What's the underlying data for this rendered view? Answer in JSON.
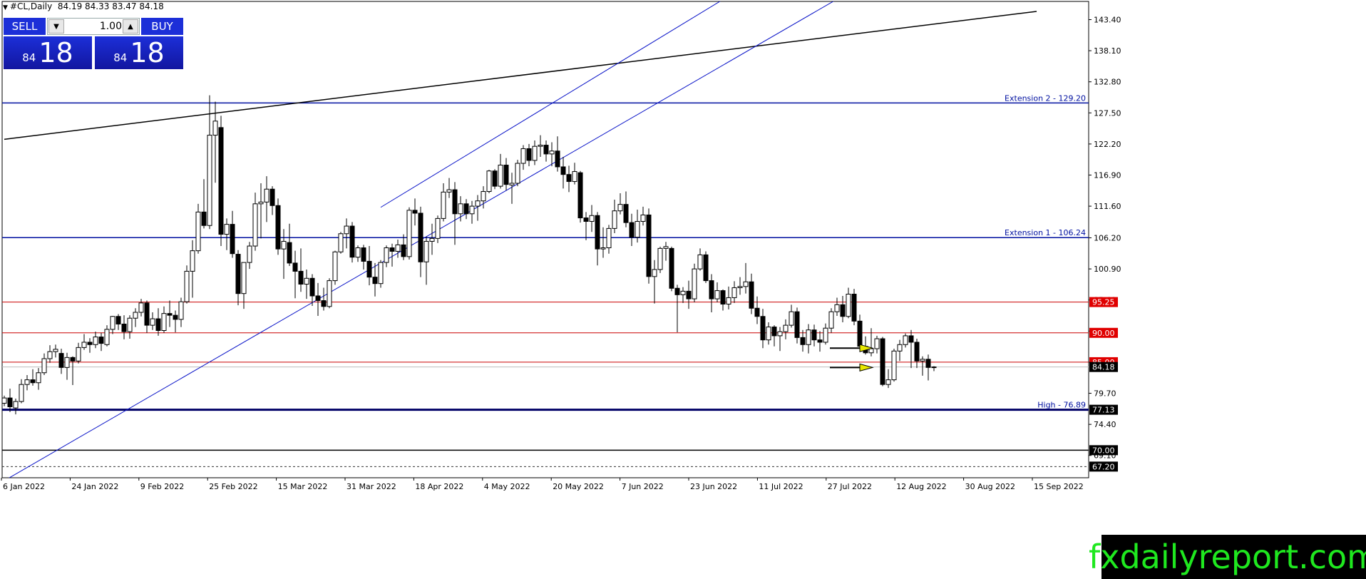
{
  "symbol": {
    "name": "#CL,Daily",
    "ohlc": "84.19 84.33 83.47 84.18"
  },
  "trade_panel": {
    "sell_label": "SELL",
    "buy_label": "BUY",
    "lot_value": "1.00",
    "sell_price_small": "84",
    "sell_price_big": "18",
    "buy_price_small": "84",
    "buy_price_big": "18",
    "down_icon": "triangle-down-icon",
    "up_icon": "triangle-up-icon"
  },
  "watermark": "fxdailyreport.com",
  "chart_data": {
    "type": "candlestick",
    "price_axis_ticks": [
      143.4,
      138.1,
      132.8,
      127.5,
      122.2,
      116.9,
      111.6,
      106.2,
      100.9,
      95.6,
      90.3,
      85.0,
      79.7,
      74.4,
      69.1
    ],
    "price_axis_ticks_text": [
      "143.40",
      "138.10",
      "132.80",
      "127.50",
      "122.20",
      "116.90",
      "111.60",
      "106.20",
      "100.90",
      "95.60",
      "90.30",
      "85.00",
      "79.70",
      "74.40",
      "69.10"
    ],
    "date_labels": [
      "6 Jan 2022",
      "24 Jan 2022",
      "9 Feb 2022",
      "25 Feb 2022",
      "15 Mar 2022",
      "31 Mar 2022",
      "18 Apr 2022",
      "4 May 2022",
      "20 May 2022",
      "7 Jun 2022",
      "23 Jun 2022",
      "11 Jul 2022",
      "27 Jul 2022",
      "12 Aug 2022",
      "30 Aug 2022",
      "15 Sep 2022"
    ],
    "ylim": [
      65.3,
      146.5
    ],
    "horizontal_levels": [
      {
        "price": 129.2,
        "color": "#0010a0",
        "width": 1.5,
        "label": "Extension 2 - 129.20",
        "label_color": "#0010a0"
      },
      {
        "price": 106.24,
        "color": "#0010a0",
        "width": 1.5,
        "label": "Extension 1 - 106.24",
        "label_color": "#0010a0"
      },
      {
        "price": 95.25,
        "color": "#cc0000",
        "width": 1,
        "badge": "95.25",
        "badge_color": "#e00000"
      },
      {
        "price": 90.0,
        "color": "#cc0000",
        "width": 1,
        "badge": "90.00",
        "badge_color": "#e00000"
      },
      {
        "price": 85.0,
        "color": "#cc0000",
        "width": 1,
        "badge": "85.00",
        "badge_color": "#e00000"
      },
      {
        "price": 84.18,
        "color": "#bbbbbb",
        "width": 1,
        "badge": "84.18",
        "badge_color": "#000000"
      },
      {
        "price": 76.89,
        "color": "#000066",
        "width": 3,
        "label": "High - 76.89",
        "label_color": "#0010a0",
        "badge": "77.13",
        "badge_color": "#000000"
      },
      {
        "price": 70.0,
        "color": "#000000",
        "width": 1.5,
        "badge": "70.00",
        "badge_color": "#000000"
      },
      {
        "price": 67.2,
        "color": "#333333",
        "width": 1,
        "dash": true,
        "badge": "67.20",
        "badge_color": "#000000"
      },
      {
        "price": 64.8,
        "color": "#cc0000",
        "width": 1
      }
    ],
    "trendlines": [
      {
        "from": [
          0,
          123.0
        ],
        "to": [
          181,
          144.8
        ],
        "color": "#000000",
        "width": 1.5
      },
      {
        "from": [
          0,
          64.8
        ],
        "to": [
          148,
          148.0
        ],
        "color": "#0a14c8",
        "width": 1
      },
      {
        "from": [
          66,
          111.4
        ],
        "to": [
          128,
          148.0
        ],
        "color": "#0a14c8",
        "width": 1
      }
    ],
    "arrows": [
      {
        "bar": 144,
        "price": 87.4,
        "color": "#e8e800"
      },
      {
        "bar": 144,
        "price": 84.1,
        "color": "#e8e800"
      }
    ],
    "candles": [
      [
        78.0,
        79.3,
        77.5,
        78.9
      ],
      [
        78.9,
        80.5,
        76.5,
        77.4
      ],
      [
        77.2,
        78.8,
        76.1,
        78.3
      ],
      [
        78.3,
        82.1,
        78.0,
        81.2
      ],
      [
        81.2,
        82.8,
        80.2,
        82.0
      ],
      [
        82.0,
        83.8,
        81.0,
        81.5
      ],
      [
        81.5,
        84.0,
        80.3,
        83.2
      ],
      [
        83.2,
        86.5,
        82.8,
        85.6
      ],
      [
        85.6,
        87.9,
        84.9,
        86.8
      ],
      [
        86.8,
        88.0,
        85.8,
        87.2
      ],
      [
        86.5,
        87.3,
        83.0,
        84.1
      ],
      [
        84.1,
        86.6,
        82.0,
        85.8
      ],
      [
        85.8,
        86.0,
        81.1,
        85.2
      ],
      [
        85.2,
        88.3,
        84.8,
        87.5
      ],
      [
        87.5,
        89.8,
        87.1,
        88.4
      ],
      [
        88.4,
        89.1,
        86.6,
        88.0
      ],
      [
        88.0,
        90.2,
        87.4,
        89.3
      ],
      [
        89.3,
        90.0,
        86.9,
        88.2
      ],
      [
        88.0,
        91.3,
        87.7,
        90.6
      ],
      [
        90.6,
        92.9,
        89.8,
        92.8
      ],
      [
        92.8,
        93.2,
        90.5,
        91.5
      ],
      [
        91.5,
        93.0,
        88.9,
        90.2
      ],
      [
        90.2,
        93.0,
        89.0,
        92.5
      ],
      [
        92.5,
        94.2,
        91.0,
        93.5
      ],
      [
        93.5,
        95.8,
        92.8,
        95.1
      ],
      [
        95.1,
        95.5,
        90.0,
        91.3
      ],
      [
        91.3,
        93.5,
        90.5,
        92.4
      ],
      [
        92.4,
        94.2,
        89.5,
        90.4
      ],
      [
        90.4,
        94.5,
        90.0,
        93.3
      ],
      [
        93.3,
        95.5,
        91.0,
        93.0
      ],
      [
        93.0,
        93.8,
        90.1,
        92.3
      ],
      [
        92.3,
        96.0,
        91.0,
        95.3
      ],
      [
        95.3,
        101.5,
        95.0,
        100.5
      ],
      [
        100.5,
        105.8,
        96.0,
        104.0
      ],
      [
        104.0,
        112.0,
        103.5,
        110.6
      ],
      [
        110.6,
        116.2,
        107.8,
        108.3
      ],
      [
        108.3,
        130.5,
        107.7,
        123.7
      ],
      [
        123.7,
        129.4,
        115.6,
        126.1
      ],
      [
        125.0,
        127.0,
        104.8,
        106.8
      ],
      [
        106.8,
        109.5,
        104.1,
        108.5
      ],
      [
        108.5,
        110.8,
        102.8,
        103.5
      ],
      [
        103.4,
        104.1,
        94.7,
        96.7
      ],
      [
        96.7,
        98.5,
        94.1,
        102.0
      ],
      [
        102.0,
        105.5,
        100.9,
        104.8
      ],
      [
        104.8,
        113.9,
        104.0,
        112.0
      ],
      [
        112.0,
        115.5,
        106.1,
        112.3
      ],
      [
        112.3,
        116.7,
        108.9,
        114.5
      ],
      [
        114.5,
        115.0,
        110.1,
        111.7
      ],
      [
        111.7,
        112.9,
        103.3,
        104.3
      ],
      [
        104.3,
        107.7,
        99.2,
        105.6
      ],
      [
        105.4,
        108.6,
        101.4,
        101.9
      ],
      [
        101.9,
        104.0,
        95.9,
        100.5
      ],
      [
        100.5,
        104.4,
        97.0,
        98.3
      ],
      [
        98.3,
        100.8,
        95.8,
        99.3
      ],
      [
        99.3,
        100.0,
        94.6,
        96.3
      ],
      [
        96.3,
        98.5,
        92.9,
        95.5
      ],
      [
        95.5,
        97.7,
        93.8,
        94.5
      ],
      [
        94.5,
        99.3,
        94.2,
        98.9
      ],
      [
        98.9,
        104.0,
        98.2,
        103.8
      ],
      [
        103.8,
        107.2,
        103.5,
        106.9
      ],
      [
        106.9,
        109.5,
        104.4,
        108.2
      ],
      [
        108.2,
        108.9,
        102.0,
        102.9
      ],
      [
        102.9,
        104.9,
        102.1,
        104.5
      ],
      [
        104.5,
        105.0,
        100.8,
        102.2
      ],
      [
        102.2,
        104.8,
        98.1,
        99.5
      ],
      [
        99.5,
        101.9,
        96.2,
        98.4
      ],
      [
        98.4,
        102.4,
        97.7,
        102.0
      ],
      [
        102.0,
        104.9,
        101.2,
        104.5
      ],
      [
        104.5,
        105.2,
        101.3,
        103.9
      ],
      [
        103.9,
        105.9,
        102.8,
        105.0
      ],
      [
        105.0,
        106.8,
        102.4,
        103.0
      ],
      [
        103.0,
        111.4,
        102.5,
        110.9
      ],
      [
        110.9,
        112.9,
        108.3,
        110.4
      ],
      [
        110.4,
        111.5,
        99.5,
        102.1
      ],
      [
        102.1,
        106.4,
        98.2,
        105.6
      ],
      [
        105.6,
        108.6,
        103.3,
        106.1
      ],
      [
        106.1,
        110.0,
        105.3,
        109.5
      ],
      [
        109.5,
        115.5,
        109.0,
        114.0
      ],
      [
        114.0,
        116.4,
        113.0,
        114.4
      ],
      [
        114.4,
        115.7,
        105.0,
        110.3
      ],
      [
        110.3,
        113.3,
        109.0,
        112.0
      ],
      [
        112.0,
        112.8,
        109.4,
        110.3
      ],
      [
        110.3,
        112.5,
        108.6,
        111.6
      ],
      [
        111.6,
        113.5,
        109.1,
        112.5
      ],
      [
        112.5,
        115.0,
        111.2,
        114.1
      ],
      [
        114.1,
        117.8,
        113.8,
        117.6
      ],
      [
        117.6,
        117.9,
        114.5,
        115.0
      ],
      [
        115.0,
        120.5,
        114.6,
        118.6
      ],
      [
        118.6,
        119.8,
        114.3,
        115.3
      ],
      [
        115.2,
        117.3,
        112.0,
        115.5
      ],
      [
        115.5,
        119.5,
        115.0,
        118.9
      ],
      [
        118.9,
        122.0,
        117.8,
        121.4
      ],
      [
        121.4,
        122.2,
        118.4,
        119.4
      ],
      [
        119.4,
        122.8,
        118.6,
        121.8
      ],
      [
        121.8,
        123.7,
        120.0,
        122.0
      ],
      [
        122.0,
        122.8,
        119.2,
        120.5
      ],
      [
        120.5,
        122.5,
        118.4,
        121.0
      ],
      [
        121.0,
        123.5,
        117.5,
        118.3
      ],
      [
        118.3,
        120.0,
        114.6,
        117.0
      ],
      [
        117.0,
        118.5,
        114.0,
        115.8
      ],
      [
        115.8,
        119.0,
        115.3,
        117.5
      ],
      [
        117.3,
        117.6,
        108.8,
        109.6
      ],
      [
        109.6,
        110.6,
        105.8,
        109.0
      ],
      [
        109.0,
        111.8,
        107.2,
        110.0
      ],
      [
        110.0,
        110.6,
        101.5,
        104.3
      ],
      [
        104.3,
        108.0,
        102.8,
        104.5
      ],
      [
        104.5,
        108.4,
        103.5,
        107.8
      ],
      [
        107.8,
        112.7,
        107.0,
        110.8
      ],
      [
        110.8,
        113.8,
        110.2,
        111.9
      ],
      [
        111.9,
        114.1,
        108.0,
        108.8
      ],
      [
        108.8,
        110.3,
        104.8,
        106.3
      ],
      [
        106.3,
        111.0,
        105.4,
        109.0
      ],
      [
        109.0,
        111.5,
        108.3,
        110.1
      ],
      [
        110.1,
        111.2,
        98.4,
        99.6
      ],
      [
        99.6,
        102.4,
        95.0,
        100.8
      ],
      [
        100.8,
        104.7,
        100.2,
        104.4
      ],
      [
        104.4,
        105.5,
        102.3,
        104.7
      ],
      [
        104.4,
        104.7,
        97.1,
        97.6
      ],
      [
        97.6,
        98.2,
        90.1,
        96.5
      ],
      [
        96.5,
        97.8,
        95.1,
        97.1
      ],
      [
        97.1,
        98.9,
        94.1,
        95.8
      ],
      [
        95.8,
        101.8,
        95.2,
        100.9
      ],
      [
        100.9,
        104.4,
        100.6,
        103.3
      ],
      [
        103.3,
        103.9,
        98.5,
        98.9
      ],
      [
        98.9,
        100.0,
        93.5,
        95.8
      ],
      [
        95.8,
        98.6,
        95.2,
        97.2
      ],
      [
        97.2,
        97.4,
        93.8,
        94.9
      ],
      [
        94.9,
        97.9,
        94.0,
        96.0
      ],
      [
        96.0,
        98.8,
        95.1,
        97.7
      ],
      [
        97.7,
        99.5,
        96.5,
        97.9
      ],
      [
        97.9,
        101.9,
        96.7,
        98.7
      ],
      [
        98.7,
        100.1,
        93.2,
        94.2
      ],
      [
        94.2,
        96.2,
        91.5,
        92.8
      ],
      [
        92.8,
        94.1,
        87.4,
        88.8
      ],
      [
        88.8,
        91.8,
        88.0,
        91.0
      ],
      [
        91.0,
        91.3,
        87.7,
        89.5
      ],
      [
        89.5,
        91.0,
        86.9,
        90.2
      ],
      [
        90.2,
        92.3,
        88.9,
        91.3
      ],
      [
        91.3,
        94.8,
        90.9,
        93.6
      ],
      [
        93.6,
        94.3,
        88.2,
        89.2
      ],
      [
        89.2,
        90.5,
        86.8,
        88.0
      ],
      [
        88.0,
        91.5,
        86.5,
        90.5
      ],
      [
        90.5,
        91.4,
        87.7,
        88.8
      ],
      [
        88.8,
        90.3,
        86.8,
        88.4
      ],
      [
        88.4,
        91.6,
        88.0,
        90.8
      ],
      [
        90.8,
        94.2,
        90.0,
        93.6
      ],
      [
        93.6,
        96.0,
        92.9,
        94.8
      ],
      [
        94.8,
        96.3,
        91.8,
        92.8
      ],
      [
        92.8,
        97.7,
        92.5,
        96.6
      ],
      [
        96.6,
        97.5,
        91.3,
        92.0
      ],
      [
        92.0,
        93.1,
        87.0,
        87.7
      ],
      [
        87.7,
        89.4,
        86.3,
        86.6
      ],
      [
        86.6,
        90.8,
        86.0,
        87.3
      ],
      [
        87.3,
        89.5,
        86.5,
        89.0
      ],
      [
        89.0,
        89.3,
        80.9,
        81.2
      ],
      [
        81.2,
        83.8,
        80.6,
        82.0
      ],
      [
        82.0,
        87.3,
        81.7,
        86.9
      ],
      [
        86.9,
        88.8,
        85.2,
        88.0
      ],
      [
        88.0,
        89.9,
        87.5,
        89.5
      ],
      [
        89.5,
        90.5,
        84.0,
        88.4
      ],
      [
        88.4,
        89.0,
        84.0,
        85.2
      ],
      [
        85.2,
        86.0,
        82.7,
        85.5
      ],
      [
        85.5,
        86.3,
        81.9,
        84.1
      ],
      [
        84.19,
        84.33,
        83.47,
        84.18
      ]
    ]
  }
}
